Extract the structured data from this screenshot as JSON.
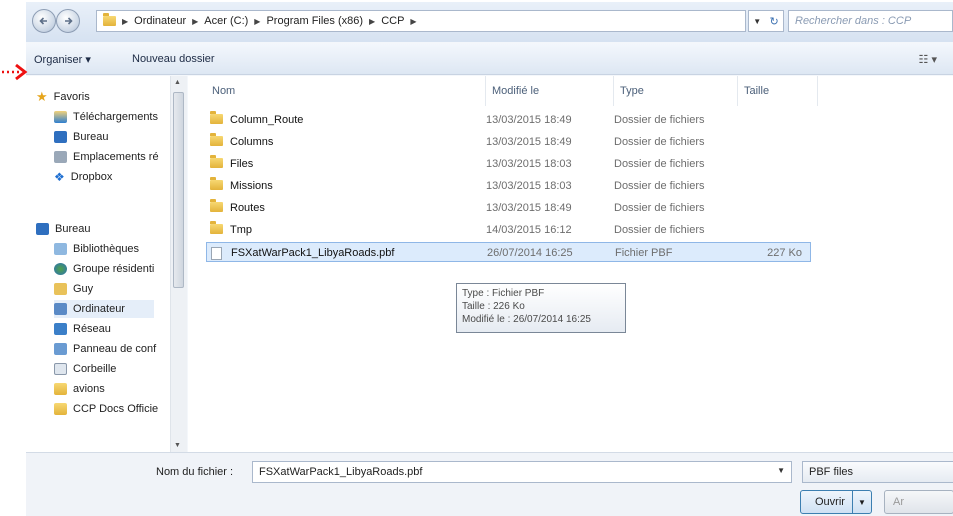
{
  "address": {
    "breadcrumbs": [
      "Ordinateur",
      "Acer (C:)",
      "Program Files (x86)",
      "CCP"
    ],
    "search_placeholder": "Rechercher dans : CCP"
  },
  "toolbar": {
    "organize_label": "Organiser ▾",
    "new_folder_label": "Nouveau dossier"
  },
  "nav": {
    "favorites_header": "Favoris",
    "favorites": [
      "Téléchargements",
      "Bureau",
      "Emplacements ré",
      "Dropbox"
    ],
    "desktop_header": "Bureau",
    "desktop_items": [
      "Bibliothèques",
      "Groupe résidenti",
      "Guy",
      "Ordinateur",
      "Réseau",
      "Panneau de conf",
      "Corbeille",
      "avions",
      "CCP Docs Officie"
    ]
  },
  "columns": {
    "name": "Nom",
    "modified": "Modifié le",
    "type": "Type",
    "size": "Taille"
  },
  "files": [
    {
      "name": "Column_Route",
      "date": "13/03/2015 18:49",
      "type": "Dossier de fichiers",
      "size": "",
      "kind": "folder"
    },
    {
      "name": "Columns",
      "date": "13/03/2015 18:49",
      "type": "Dossier de fichiers",
      "size": "",
      "kind": "folder"
    },
    {
      "name": "Files",
      "date": "13/03/2015 18:03",
      "type": "Dossier de fichiers",
      "size": "",
      "kind": "folder"
    },
    {
      "name": "Missions",
      "date": "13/03/2015 18:03",
      "type": "Dossier de fichiers",
      "size": "",
      "kind": "folder"
    },
    {
      "name": "Routes",
      "date": "13/03/2015 18:49",
      "type": "Dossier de fichiers",
      "size": "",
      "kind": "folder"
    },
    {
      "name": "Tmp",
      "date": "14/03/2015 16:12",
      "type": "Dossier de fichiers",
      "size": "",
      "kind": "folder"
    },
    {
      "name": "FSXatWarPack1_LibyaRoads.pbf",
      "date": "26/07/2014 16:25",
      "type": "Fichier PBF",
      "size": "227 Ko",
      "kind": "file"
    }
  ],
  "tooltip": {
    "line1": "Type : Fichier PBF",
    "line2": "Taille : 226 Ko",
    "line3": "Modifié le : 26/07/2014 16:25"
  },
  "bottom": {
    "filename_label": "Nom du fichier :",
    "filename_value": "FSXatWarPack1_LibyaRoads.pbf",
    "filter_value": "PBF files",
    "open_label": "Ouvrir",
    "cancel_label": "Ar"
  }
}
